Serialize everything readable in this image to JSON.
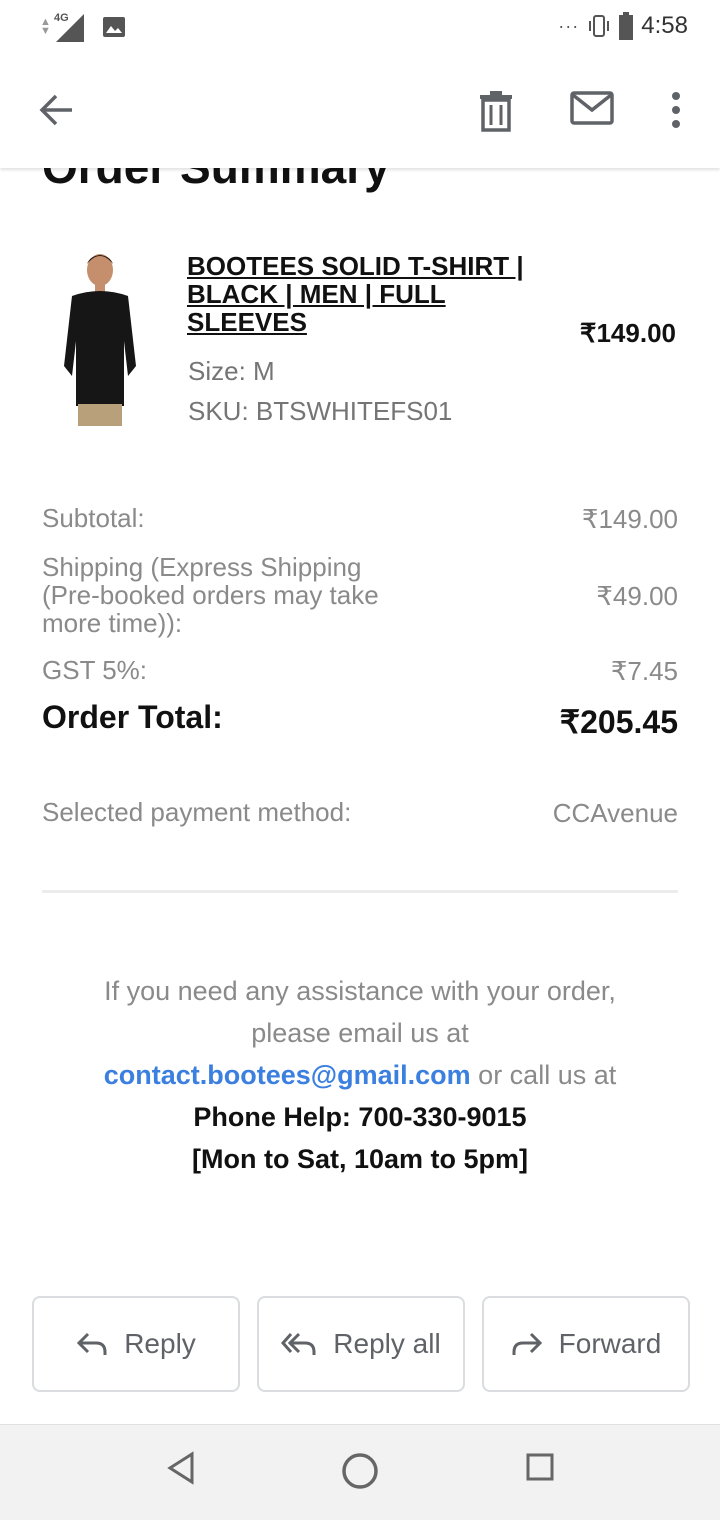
{
  "status_bar": {
    "network": "4G",
    "overflow": "···",
    "time": "4:58"
  },
  "app_bar": {
    "back_icon": "arrow-left-icon",
    "delete_icon": "trash-icon",
    "mail_icon": "mail-icon",
    "more_icon": "more-vert-icon"
  },
  "email": {
    "title": "Order Summary",
    "product": {
      "name": "BOOTEES SOLID T-SHIRT | BLACK | MEN | FULL SLEEVES",
      "price": "₹149.00",
      "size": "Size: M",
      "sku": "SKU: BTSWHITEFS01"
    },
    "totals": [
      {
        "label": "Subtotal:",
        "value": "₹149.00"
      },
      {
        "label": "Shipping (Express Shipping (Pre-booked orders may take more time)):",
        "value": "₹49.00"
      },
      {
        "label": "GST 5%:",
        "value": "₹7.45"
      }
    ],
    "order_total": {
      "label": "Order Total:",
      "value": "₹205.45"
    },
    "payment": {
      "label": "Selected payment method:",
      "value": "CCAvenue"
    },
    "help": {
      "text1": "If you need any assistance with your order, please email us at",
      "email": "contact.bootees@gmail.com",
      "text2": "or call us at",
      "phone": "Phone Help: 700-330-9015",
      "hours": "[Mon to Sat, 10am to 5pm]"
    }
  },
  "actions": {
    "reply": "Reply",
    "reply_all": "Reply all",
    "forward": "Forward"
  },
  "nav": {
    "back": "nav-back-icon",
    "home": "nav-home-icon",
    "recents": "nav-recents-icon"
  }
}
